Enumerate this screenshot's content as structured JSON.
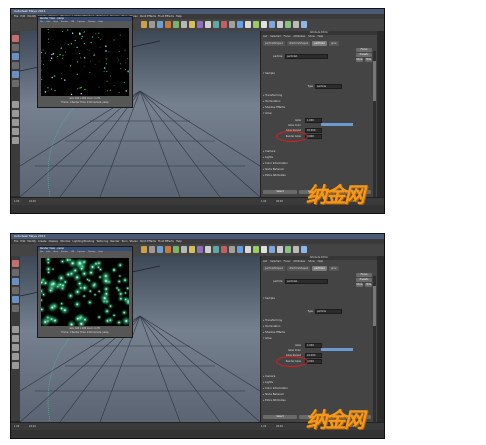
{
  "app": {
    "title": "Autodesk Maya 2011",
    "menus": [
      "File",
      "Edit",
      "Modify",
      "Create",
      "Display",
      "Window",
      "Lighting/Shading",
      "Texturing",
      "Render",
      "Toon",
      "Stereo",
      "Paint Effects",
      "Fluid Effects",
      "Help"
    ],
    "shelf_tabs": [
      "General",
      "Curves",
      "Surfaces",
      "Polygons",
      "Subdivs",
      "Deformation",
      "Animation",
      "Dynamics",
      "Rendering",
      "PaintEffects",
      "Toon",
      "Muscle",
      "Fluids",
      "Fur",
      "Hair",
      "nCloth",
      "Custom"
    ]
  },
  "render_view": {
    "title": "Render View - persp",
    "menu": [
      "File",
      "Edit",
      "View",
      "Render",
      "IPR",
      "Options",
      "Display",
      "Help"
    ],
    "caption_line1": "size: 640 x 480  zoom: 0.271",
    "caption_line2": "Frame: 1   Render Time: 0:00   Camera: persp"
  },
  "attribute_editor": {
    "header": "Attribute Editor",
    "tabs": [
      "List",
      "Selected",
      "Focus",
      "Attributes",
      "Show",
      "Help"
    ],
    "node_tabs": [
      "particleShape1",
      "nParticleShape1",
      "particle1",
      "glow"
    ],
    "active_node": "particle1",
    "focus_btn": "Focus",
    "presets_btn": "Presets",
    "show_btn": "Show",
    "hide_btn": "Hide",
    "node_label": "particle:",
    "node_value": "particle1",
    "sample_label": "Sample",
    "type_label": "Type",
    "type_value": "particle",
    "sections_top": [
      "Transforming",
      "Illumination",
      "Shadow Effects"
    ],
    "open_section": "Glow",
    "fields": [
      {
        "label": "Glow",
        "value": "1.000"
      },
      {
        "label": "Glow Color",
        "value": ""
      },
      {
        "label": "Glow Spread",
        "value": "10.000"
      },
      {
        "label": "Render Glow",
        "value": "0.000"
      }
    ],
    "highlighted_field": "Render Glow",
    "sections_bottom": [
      "Camera",
      "Lights",
      "Color Information",
      "Node Behavior",
      "Extra Attributes"
    ],
    "select_btn": "Select",
    "load_btn": "Load Attributes",
    "copy_btn": "Copy Tab"
  },
  "statusbar": {
    "start": "1.00",
    "end": "24.00",
    "range_start": "1.00",
    "range_end": "48.00",
    "current": "1.00"
  },
  "watermark": "纳金网",
  "colors": {
    "accent": "#6a9bd1",
    "highlight": "#d42020",
    "watermark": "#f39a1e"
  }
}
